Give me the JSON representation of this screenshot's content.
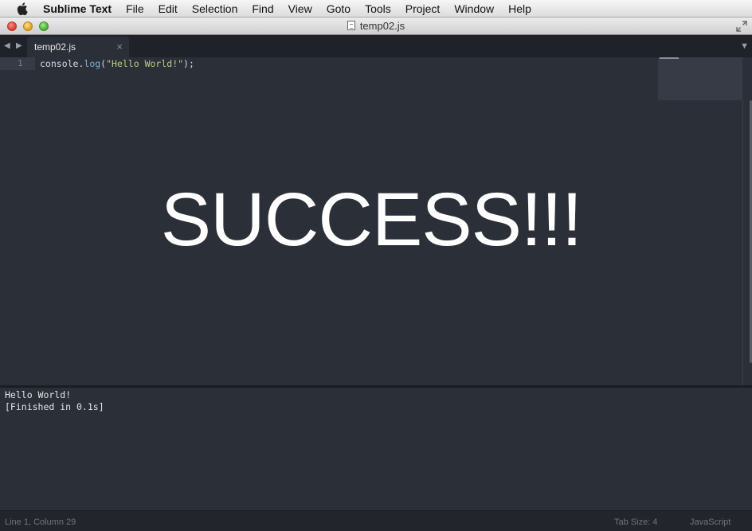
{
  "menubar": {
    "app_name": "Sublime Text",
    "items": [
      "File",
      "Edit",
      "Selection",
      "Find",
      "View",
      "Goto",
      "Tools",
      "Project",
      "Window",
      "Help"
    ]
  },
  "window": {
    "title": "temp02.js"
  },
  "tabs": [
    {
      "label": "temp02.js",
      "active": true
    }
  ],
  "editor": {
    "line_number": "1",
    "code": {
      "object": "console.",
      "method": "log",
      "open": "(",
      "string": "\"Hello World!\"",
      "close": ");"
    },
    "overlay_text": "SUCCESS!!!"
  },
  "output": {
    "lines": [
      "Hello World!",
      "[Finished in 0.1s]"
    ]
  },
  "statusbar": {
    "position": "Line 1, Column 29",
    "tab_size": "Tab Size: 4",
    "syntax": "JavaScript"
  },
  "icons": {
    "apple": "apple-logo-icon",
    "tab_close": "close-icon",
    "nav_left": "chevron-left-icon",
    "nav_right": "chevron-right-icon",
    "dropdown": "chevron-down-icon",
    "fullscreen": "fullscreen-icon",
    "document": "document-icon"
  },
  "colors": {
    "editor_bg": "#2b2f38",
    "string": "#b5cf7d",
    "function": "#7fb2d8"
  }
}
